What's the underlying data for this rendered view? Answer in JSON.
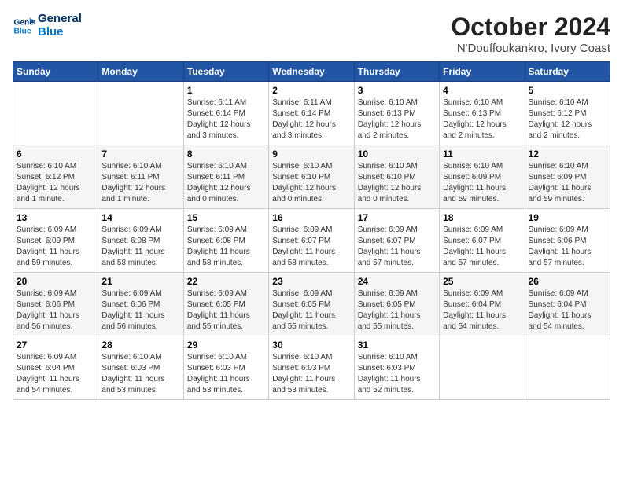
{
  "logo": {
    "line1": "General",
    "line2": "Blue"
  },
  "title": "October 2024",
  "location": "N'Douffoukankro, Ivory Coast",
  "weekdays": [
    "Sunday",
    "Monday",
    "Tuesday",
    "Wednesday",
    "Thursday",
    "Friday",
    "Saturday"
  ],
  "weeks": [
    [
      {
        "day": "",
        "info": ""
      },
      {
        "day": "",
        "info": ""
      },
      {
        "day": "1",
        "info": "Sunrise: 6:11 AM\nSunset: 6:14 PM\nDaylight: 12 hours\nand 3 minutes."
      },
      {
        "day": "2",
        "info": "Sunrise: 6:11 AM\nSunset: 6:14 PM\nDaylight: 12 hours\nand 3 minutes."
      },
      {
        "day": "3",
        "info": "Sunrise: 6:10 AM\nSunset: 6:13 PM\nDaylight: 12 hours\nand 2 minutes."
      },
      {
        "day": "4",
        "info": "Sunrise: 6:10 AM\nSunset: 6:13 PM\nDaylight: 12 hours\nand 2 minutes."
      },
      {
        "day": "5",
        "info": "Sunrise: 6:10 AM\nSunset: 6:12 PM\nDaylight: 12 hours\nand 2 minutes."
      }
    ],
    [
      {
        "day": "6",
        "info": "Sunrise: 6:10 AM\nSunset: 6:12 PM\nDaylight: 12 hours\nand 1 minute."
      },
      {
        "day": "7",
        "info": "Sunrise: 6:10 AM\nSunset: 6:11 PM\nDaylight: 12 hours\nand 1 minute."
      },
      {
        "day": "8",
        "info": "Sunrise: 6:10 AM\nSunset: 6:11 PM\nDaylight: 12 hours\nand 0 minutes."
      },
      {
        "day": "9",
        "info": "Sunrise: 6:10 AM\nSunset: 6:10 PM\nDaylight: 12 hours\nand 0 minutes."
      },
      {
        "day": "10",
        "info": "Sunrise: 6:10 AM\nSunset: 6:10 PM\nDaylight: 12 hours\nand 0 minutes."
      },
      {
        "day": "11",
        "info": "Sunrise: 6:10 AM\nSunset: 6:09 PM\nDaylight: 11 hours\nand 59 minutes."
      },
      {
        "day": "12",
        "info": "Sunrise: 6:10 AM\nSunset: 6:09 PM\nDaylight: 11 hours\nand 59 minutes."
      }
    ],
    [
      {
        "day": "13",
        "info": "Sunrise: 6:09 AM\nSunset: 6:09 PM\nDaylight: 11 hours\nand 59 minutes."
      },
      {
        "day": "14",
        "info": "Sunrise: 6:09 AM\nSunset: 6:08 PM\nDaylight: 11 hours\nand 58 minutes."
      },
      {
        "day": "15",
        "info": "Sunrise: 6:09 AM\nSunset: 6:08 PM\nDaylight: 11 hours\nand 58 minutes."
      },
      {
        "day": "16",
        "info": "Sunrise: 6:09 AM\nSunset: 6:07 PM\nDaylight: 11 hours\nand 58 minutes."
      },
      {
        "day": "17",
        "info": "Sunrise: 6:09 AM\nSunset: 6:07 PM\nDaylight: 11 hours\nand 57 minutes."
      },
      {
        "day": "18",
        "info": "Sunrise: 6:09 AM\nSunset: 6:07 PM\nDaylight: 11 hours\nand 57 minutes."
      },
      {
        "day": "19",
        "info": "Sunrise: 6:09 AM\nSunset: 6:06 PM\nDaylight: 11 hours\nand 57 minutes."
      }
    ],
    [
      {
        "day": "20",
        "info": "Sunrise: 6:09 AM\nSunset: 6:06 PM\nDaylight: 11 hours\nand 56 minutes."
      },
      {
        "day": "21",
        "info": "Sunrise: 6:09 AM\nSunset: 6:06 PM\nDaylight: 11 hours\nand 56 minutes."
      },
      {
        "day": "22",
        "info": "Sunrise: 6:09 AM\nSunset: 6:05 PM\nDaylight: 11 hours\nand 55 minutes."
      },
      {
        "day": "23",
        "info": "Sunrise: 6:09 AM\nSunset: 6:05 PM\nDaylight: 11 hours\nand 55 minutes."
      },
      {
        "day": "24",
        "info": "Sunrise: 6:09 AM\nSunset: 6:05 PM\nDaylight: 11 hours\nand 55 minutes."
      },
      {
        "day": "25",
        "info": "Sunrise: 6:09 AM\nSunset: 6:04 PM\nDaylight: 11 hours\nand 54 minutes."
      },
      {
        "day": "26",
        "info": "Sunrise: 6:09 AM\nSunset: 6:04 PM\nDaylight: 11 hours\nand 54 minutes."
      }
    ],
    [
      {
        "day": "27",
        "info": "Sunrise: 6:09 AM\nSunset: 6:04 PM\nDaylight: 11 hours\nand 54 minutes."
      },
      {
        "day": "28",
        "info": "Sunrise: 6:10 AM\nSunset: 6:03 PM\nDaylight: 11 hours\nand 53 minutes."
      },
      {
        "day": "29",
        "info": "Sunrise: 6:10 AM\nSunset: 6:03 PM\nDaylight: 11 hours\nand 53 minutes."
      },
      {
        "day": "30",
        "info": "Sunrise: 6:10 AM\nSunset: 6:03 PM\nDaylight: 11 hours\nand 53 minutes."
      },
      {
        "day": "31",
        "info": "Sunrise: 6:10 AM\nSunset: 6:03 PM\nDaylight: 11 hours\nand 52 minutes."
      },
      {
        "day": "",
        "info": ""
      },
      {
        "day": "",
        "info": ""
      }
    ]
  ]
}
